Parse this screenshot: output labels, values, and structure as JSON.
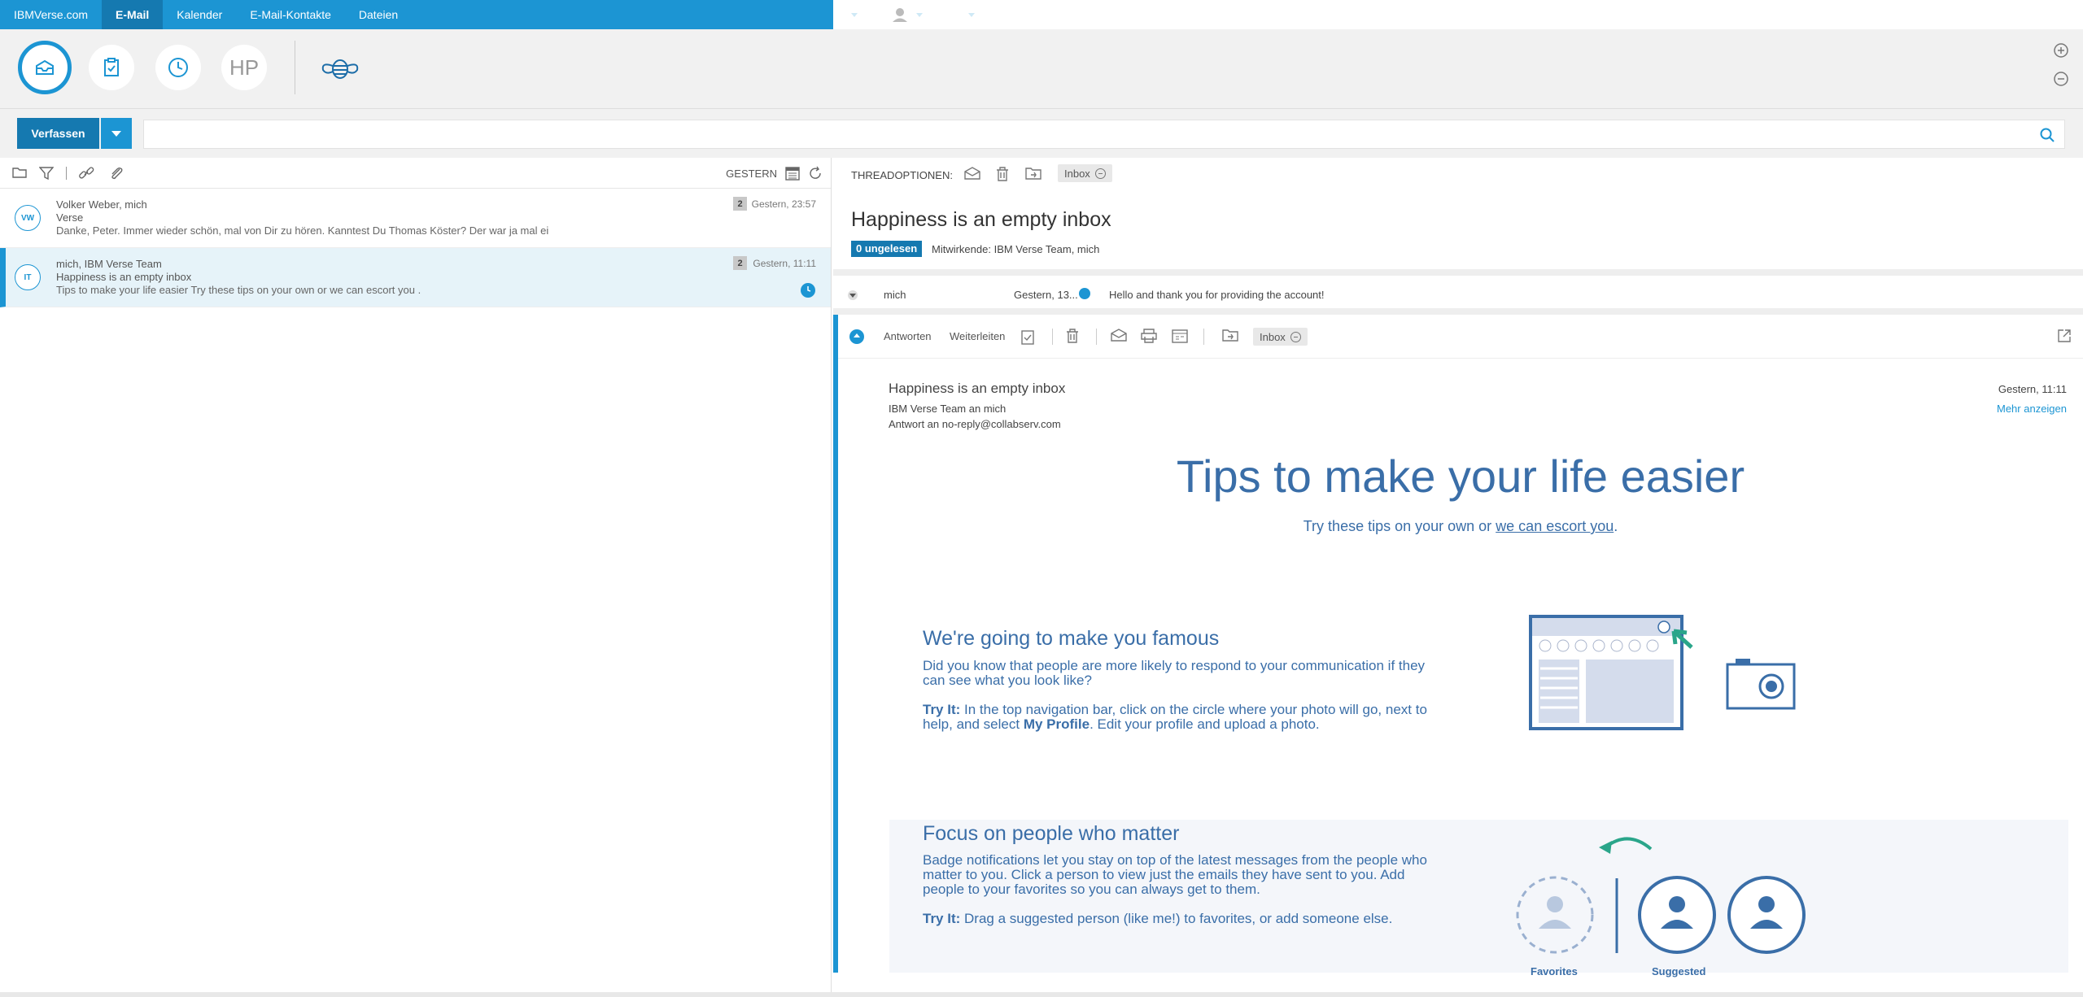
{
  "topnav": {
    "items": [
      {
        "label": "IBMVerse.com"
      },
      {
        "label": "E-Mail",
        "active": true
      },
      {
        "label": "Kalender"
      },
      {
        "label": "E-Mail-Kontakte"
      },
      {
        "label": "Dateien"
      }
    ],
    "right_icons": [
      "lightbulb-icon",
      "user-avatar-icon",
      "help-icon"
    ],
    "help_glyph": "?"
  },
  "bizbar": {
    "buttons": [
      "inbox-icon",
      "todo-icon",
      "waiting-icon",
      "hp-avatar",
      "bee-icon"
    ],
    "hp_text": "HP"
  },
  "compose": {
    "label": "Verfassen"
  },
  "search": {
    "placeholder": "",
    "value": ""
  },
  "list_toolbar": {
    "date_label": "GESTERN"
  },
  "mail_list": [
    {
      "initials": "VW",
      "from": "Volker Weber, mich",
      "subject": "Verse",
      "preview": "Danke, Peter. Immer wieder schön, mal von Dir zu hören. Kanntest Du Thomas Köster? Der war ja mal ei",
      "count": "2",
      "time": "Gestern, 23:57",
      "selected": false
    },
    {
      "initials": "IT",
      "from": "mich, IBM Verse Team",
      "subject": "Happiness is an empty inbox",
      "preview": "Tips to make your life easier Try these tips on your own or we can escort you .",
      "count": "2",
      "time": "Gestern, 11:11",
      "selected": true
    }
  ],
  "thread": {
    "options_label": "THREADOPTIONEN:",
    "folder": "Inbox",
    "title": "Happiness is an empty inbox",
    "unread": "0 ungelesen",
    "contributors": "Mitwirkende: IBM Verse Team, mich"
  },
  "collapsed_message": {
    "from": "mich",
    "time": "Gestern, 13...",
    "snippet": "Hello and thank you for providing the account!"
  },
  "open_message": {
    "reply": "Antworten",
    "forward": "Weiterleiten",
    "folder": "Inbox",
    "subject": "Happiness is an empty inbox",
    "to": "IBM Verse Team an mich",
    "reply_to": "Antwort an no-reply@collabserv.com",
    "date": "Gestern, 11:11",
    "more": "Mehr anzeigen"
  },
  "newsletter": {
    "title": "Tips to make your life easier",
    "sub_pre": "Try these tips on your own or ",
    "sub_link": "we can escort you",
    "sub_post": ".",
    "sec1": {
      "heading": "We're going to make you famous",
      "p1": "Did you know that people are more likely to respond to your communication if they can see what you look like?",
      "tryit": "Try It:",
      "p2_a": " In the top navigation bar, click on the circle where your photo will go, next to help, and select ",
      "p2_b": "My Profile",
      "p2_c": ". Edit your profile and upload a photo."
    },
    "sec2": {
      "heading": "Focus on people who matter",
      "p1": "Badge notifications let you stay on top of the latest messages from the people who matter to you. Click a person to view just the emails they have sent to you. Add people to your favorites so you can always get to them.",
      "tryit": "Try It:",
      "p2": " Drag a suggested person (like me!) to favorites, or add someone else.",
      "label_fav": "Favorites",
      "label_sugg": "Suggested"
    }
  },
  "colors": {
    "accent": "#1c95d3",
    "accent_dark": "#1579b0",
    "newsletter_blue": "#3a6ea8",
    "teal": "#2aa58a"
  }
}
